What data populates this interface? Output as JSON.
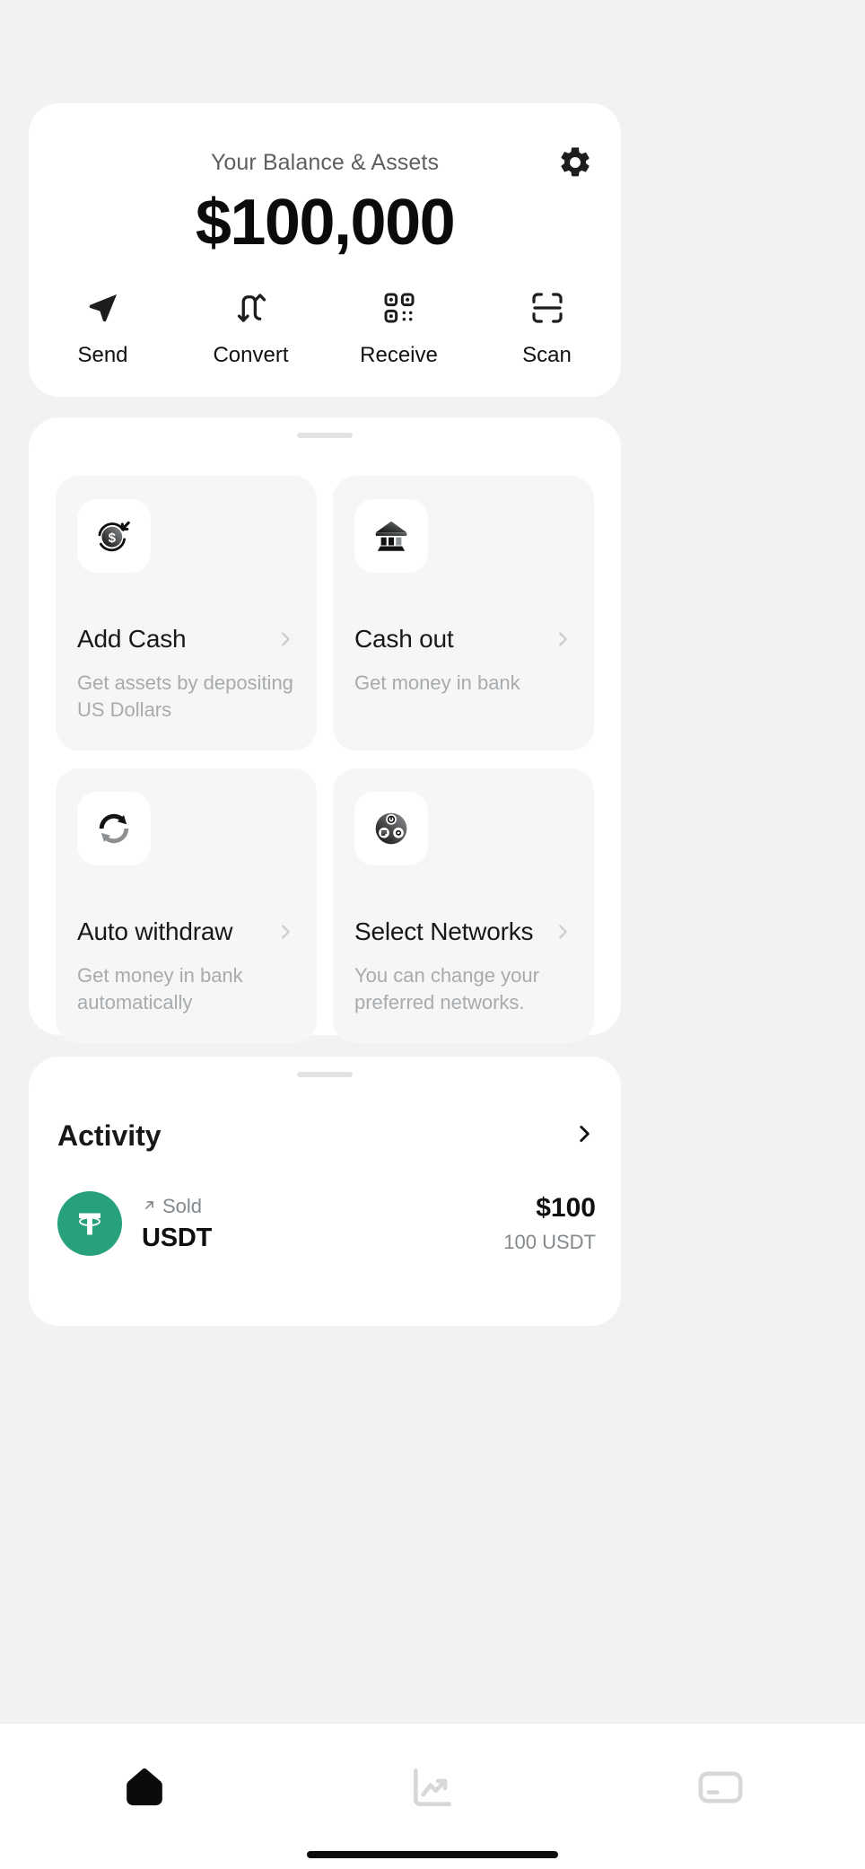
{
  "balance": {
    "title": "Your Balance & Assets",
    "amount": "$100,000",
    "settings_icon": "gear-icon",
    "actions": [
      {
        "label": "Send",
        "icon": "send-paper-plane-icon"
      },
      {
        "label": "Convert",
        "icon": "convert-arrows-icon"
      },
      {
        "label": "Receive",
        "icon": "qr-code-icon"
      },
      {
        "label": "Scan",
        "icon": "scan-frame-icon"
      }
    ]
  },
  "features": {
    "tiles": [
      {
        "title": "Add Cash",
        "subtitle": "Get assets by depositing US Dollars",
        "icon": "dollar-coin-arrow-icon",
        "chevron": "chevron-right-icon"
      },
      {
        "title": "Cash out",
        "subtitle": "Get money in bank",
        "icon": "bank-building-icon",
        "chevron": "chevron-right-icon"
      },
      {
        "title": "Auto withdraw",
        "subtitle": "Get money in bank automatically",
        "icon": "sync-arrows-icon",
        "chevron": "chevron-right-icon"
      },
      {
        "title": "Select Networks",
        "subtitle": "You can change your preferred networks.",
        "icon": "network-nodes-icon",
        "chevron": "chevron-right-icon"
      }
    ]
  },
  "activity": {
    "heading": "Activity",
    "more_icon": "chevron-right-icon",
    "rows": [
      {
        "kind": "Sold",
        "direction_icon": "arrow-up-right-icon",
        "symbol": "USDT",
        "fiat": "$100",
        "units": "100 USDT",
        "coin_icon": "tether-logo-icon",
        "coin_color": "#26a17b"
      }
    ]
  },
  "bottom_nav": {
    "items": [
      {
        "name": "home",
        "icon": "home-icon",
        "active": true
      },
      {
        "name": "markets",
        "icon": "trending-up-icon",
        "active": false
      },
      {
        "name": "card",
        "icon": "card-icon",
        "active": false
      }
    ]
  },
  "colors": {
    "background": "#f1f2f2",
    "card": "#ffffff",
    "tile": "#f6f6f6",
    "text_primary": "#16181a",
    "text_muted": "#a7abae",
    "accent_green": "#26a17b"
  }
}
